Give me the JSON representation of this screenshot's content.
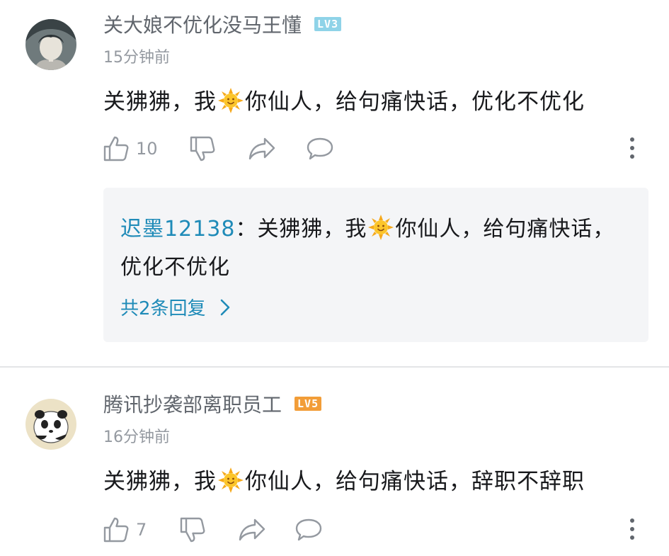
{
  "comments": [
    {
      "username": "关大娘不优化没马王懂",
      "level": "LV3",
      "level_color": "#8fd3e8",
      "time": "15分钟前",
      "content_before": "关狒狒，我",
      "content_after": "你仙人，给句痛快话，优化不优化",
      "likes": "10",
      "reply": {
        "author": "迟墨12138",
        "separator": "：",
        "text_before": "关狒狒，我",
        "text_after": "你仙人，给句痛快话，优化不优化",
        "more_label": "共2条回复"
      }
    },
    {
      "username": "腾讯抄袭部离职员工",
      "level": "LV5",
      "level_color": "#f29d38",
      "time": "16分钟前",
      "content_before": "关狒狒，我",
      "content_after": "你仙人，给句痛快话，辞职不辞职",
      "likes": "7"
    }
  ],
  "icons": {
    "like": "thumbs-up-icon",
    "dislike": "thumbs-down-icon",
    "share": "share-icon",
    "reply": "comment-icon",
    "more": "more-vertical-icon",
    "emoji": "sun-emoji-icon",
    "chevron": "chevron-right-icon"
  },
  "colors": {
    "link": "#1f8bb8",
    "secondary_text": "#9499a0",
    "username_text": "#61666d"
  }
}
